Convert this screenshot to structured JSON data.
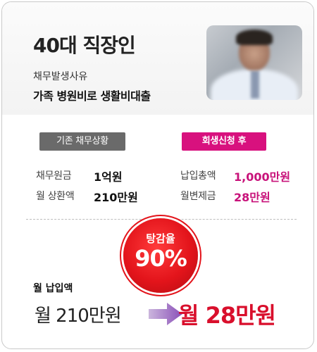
{
  "header": {
    "title": "40대 직장인",
    "reason_label": "채무발생사유",
    "reason_text": "가족 병원비로 생활비대출"
  },
  "before": {
    "badge": "기존 채무상황",
    "items": [
      {
        "label": "채무원금",
        "value": "1억원"
      },
      {
        "label": "월 상환액",
        "value": "210만원"
      }
    ]
  },
  "after": {
    "badge": "회생신청 후",
    "items": [
      {
        "label": "납입총액",
        "value": "1,000만원"
      },
      {
        "label": "월변제금",
        "value": "28만원"
      }
    ]
  },
  "reduction": {
    "label": "탕감율",
    "value": "90%"
  },
  "payment": {
    "label": "월 납입액",
    "before": "월 210만원",
    "after": "월 28만원"
  },
  "colors": {
    "accent_pink": "#c8127a",
    "accent_red": "#e3141b",
    "badge_gray": "#6a6a6a"
  },
  "icons": {
    "arrow": "right-arrow-icon"
  }
}
